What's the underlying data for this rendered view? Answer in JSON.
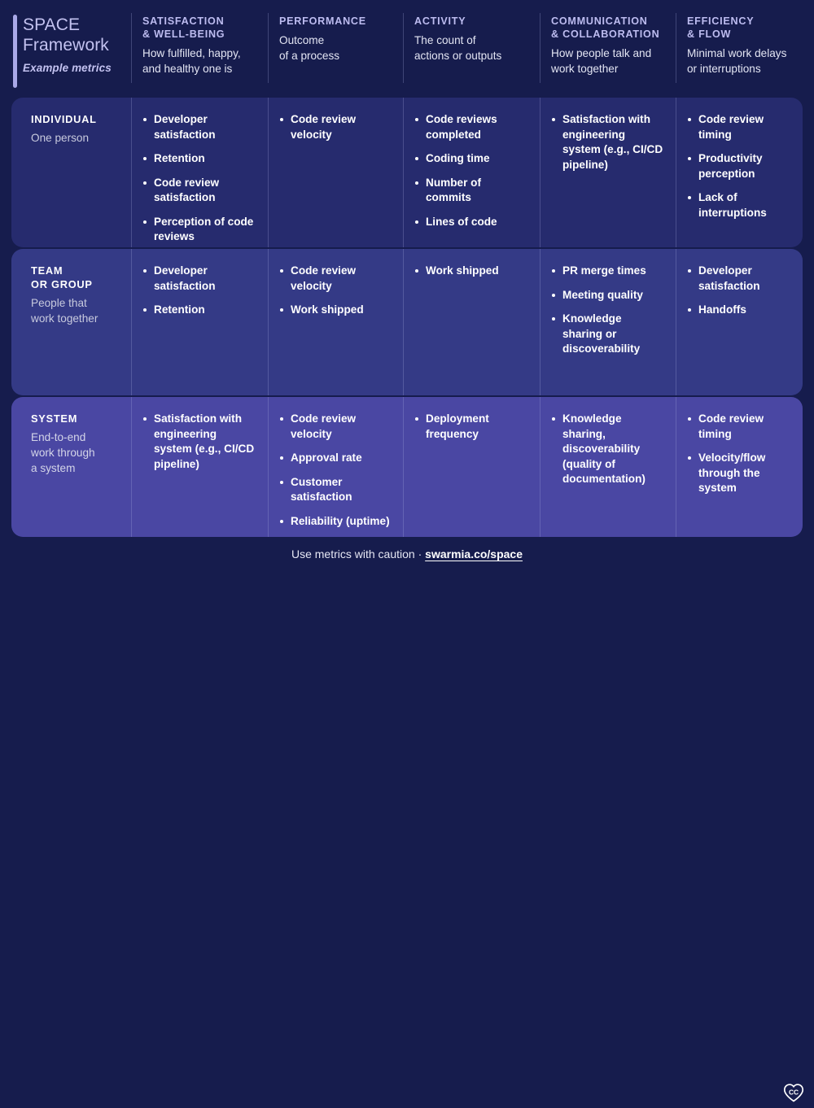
{
  "brand": {
    "title": "SPACE\nFramework",
    "subtitle": "Example metrics"
  },
  "colors": {
    "page_bg": "#161c4d",
    "row_1_bg": "#262b6e",
    "row_2_bg": "#343a86",
    "row_3_bg": "#4a47a3",
    "accent": "#a9a8e8",
    "heading": "#bdbcf0",
    "text": "#ffffff"
  },
  "columns": [
    {
      "title": "SATISFACTION\n& WELL-BEING",
      "desc": "How fulfilled, happy,\nand healthy one is"
    },
    {
      "title": "PERFORMANCE",
      "desc": "Outcome\nof a process"
    },
    {
      "title": "ACTIVITY",
      "desc": "The count of\nactions or outputs"
    },
    {
      "title": "COMMUNICATION\n& COLLABORATION",
      "desc": "How people talk and\nwork together"
    },
    {
      "title": "EFFICIENCY\n& FLOW",
      "desc": "Minimal work delays\nor interruptions"
    }
  ],
  "rows": [
    {
      "label": "INDIVIDUAL",
      "desc": "One person",
      "cells": [
        [
          "Developer satisfaction",
          "Retention",
          "Code review satisfaction",
          "Perception of code reviews"
        ],
        [
          "Code review velocity"
        ],
        [
          "Code reviews completed",
          "Coding time",
          "Number of commits",
          "Lines of code"
        ],
        [
          "Satisfaction with engineering system (e.g., CI/CD pipeline)"
        ],
        [
          "Code review timing",
          "Productivity perception",
          "Lack of interruptions"
        ]
      ]
    },
    {
      "label": "TEAM\nOR GROUP",
      "desc": "People that\nwork together",
      "cells": [
        [
          "Developer satisfaction",
          "Retention"
        ],
        [
          "Code review velocity",
          "Work shipped"
        ],
        [
          "Work shipped"
        ],
        [
          "PR merge times",
          "Meeting quality",
          "Knowledge sharing or discoverability"
        ],
        [
          "Developer satisfaction",
          "Handoffs"
        ]
      ]
    },
    {
      "label": "SYSTEM",
      "desc": "End-to-end\nwork through\na system",
      "cells": [
        [
          "Satisfaction with engineering system (e.g., CI/CD pipeline)"
        ],
        [
          "Code review velocity",
          "Approval rate",
          "Customer satisfaction",
          "Reliability (uptime)"
        ],
        [
          "Deployment frequency"
        ],
        [
          "Knowledge sharing, discoverability (quality of documentation)"
        ],
        [
          "Code review timing",
          "Velocity/flow through the system"
        ]
      ]
    }
  ],
  "footer": {
    "caption": "Use metrics with caution · ",
    "link": "swarmia.co/space",
    "badge": "CC"
  }
}
